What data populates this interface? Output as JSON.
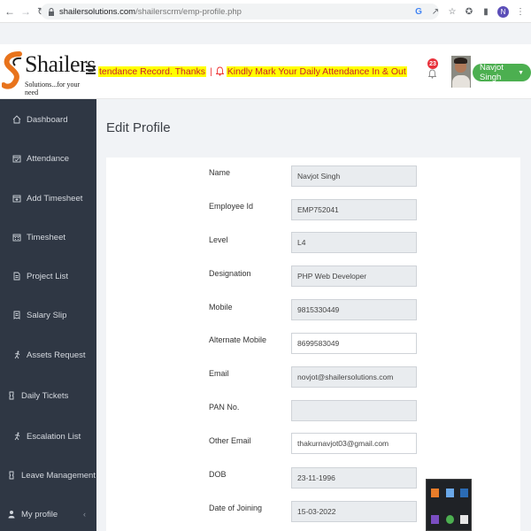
{
  "browser": {
    "url_host": "shailersolutions.com",
    "url_path": "/shailerscrm/emp-profile.php",
    "profile_initial": "N",
    "icons": [
      "back-arrow-icon",
      "forward-arrow-icon",
      "reload-icon",
      "lock-icon",
      "google-icon",
      "share-icon",
      "star-icon",
      "extensions-icon",
      "sidebar-icon"
    ]
  },
  "header": {
    "logo_text": "Shailers",
    "logo_tagline": "Solutions...for your need",
    "marquee_text_1": "tendance Record. Thanks",
    "marquee_separator": "|",
    "marquee_text_2": "Kindly Mark Your Daily Attendance In & Out",
    "notification_count": "23",
    "user_name": "Navjot Singh",
    "colors": {
      "user_pill": "#4caf50",
      "badge": "#e8323c",
      "highlight": "#ffff00",
      "marquee_text": "#c8202a"
    }
  },
  "sidebar": {
    "background": "#2f3744",
    "items": [
      {
        "label": "Dashboard",
        "icon": "home-icon"
      },
      {
        "label": "Attendance",
        "icon": "calendar-check-icon"
      },
      {
        "label": "Add Timesheet",
        "icon": "calendar-plus-icon"
      },
      {
        "label": "Timesheet",
        "icon": "calendar-icon"
      },
      {
        "label": "Project List",
        "icon": "document-icon"
      },
      {
        "label": "Salary Slip",
        "icon": "receipt-icon"
      },
      {
        "label": "Assets Request",
        "icon": "running-icon"
      },
      {
        "label": "Daily Tickets",
        "icon": "ticket-icon"
      },
      {
        "label": "Escalation List",
        "icon": "running-icon"
      },
      {
        "label": "Leave Management",
        "icon": "ticket-icon",
        "chevron": "‹"
      },
      {
        "label": "My profile",
        "icon": "user-icon",
        "chevron": "‹"
      }
    ]
  },
  "main": {
    "title": "Edit Profile",
    "fields": [
      {
        "label": "Name",
        "value": "Navjot Singh",
        "readonly": true
      },
      {
        "label": "Employee Id",
        "value": "EMP752041",
        "readonly": true
      },
      {
        "label": "Level",
        "value": "L4",
        "readonly": true
      },
      {
        "label": "Designation",
        "value": "PHP Web Developer",
        "readonly": true
      },
      {
        "label": "Mobile",
        "value": "9815330449",
        "readonly": true
      },
      {
        "label": "Alternate Mobile",
        "value": "8699583049",
        "readonly": false
      },
      {
        "label": "Email",
        "value": "novjot@shailersolutions.com",
        "readonly": true
      },
      {
        "label": "PAN No.",
        "value": "",
        "readonly": true
      },
      {
        "label": "Other Email",
        "value": "thakurnavjot03@gmail.com",
        "readonly": false
      },
      {
        "label": "DOB",
        "value": "23-11-1996",
        "readonly": true
      },
      {
        "label": "Date of Joining",
        "value": "15-03-2022",
        "readonly": true
      }
    ]
  }
}
